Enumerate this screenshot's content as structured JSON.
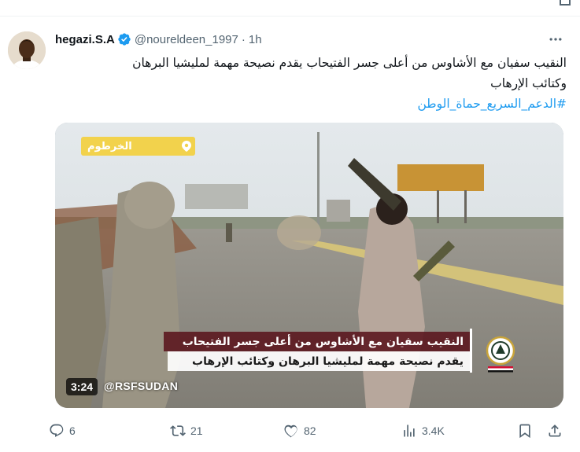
{
  "tweet": {
    "display_name": "hegazi.S.A",
    "handle": "@noureldeen_1997",
    "separator": "·",
    "time": "1h",
    "text_line1": "النقيب سفيان مع الأشاوس من أعلى جسر الفتيحاب يقدم نصيحة مهمة لمليشيا البرهان",
    "text_line2": "وكتائب الإرهاب",
    "hashtag": "#الدعم_السريع_حماة_الوطن"
  },
  "media": {
    "city_label": "الخرطوم",
    "caption_line1": "النقيب سفيان مع الأشاوس من أعلى جسر الفتيحاب",
    "caption_line2": "يقدم نصيحة مهمة لمليشيا البرهان وكتائب الإرهاب",
    "duration": "3:24",
    "watermark": "@RSFSUDAN"
  },
  "actions": {
    "replies": "6",
    "reposts": "21",
    "likes": "82",
    "views": "3.4K"
  },
  "icons": {
    "verified": "verified-badge-icon",
    "more": "more-icon",
    "reply": "reply-icon",
    "repost": "repost-icon",
    "like": "like-icon",
    "views": "views-icon",
    "bookmark": "bookmark-icon",
    "share": "share-icon"
  },
  "colors": {
    "accent": "#1d9bf0",
    "secondary_text": "#536471",
    "badge_yellow": "#f2d24c",
    "caption_maroon": "#5a141c"
  }
}
